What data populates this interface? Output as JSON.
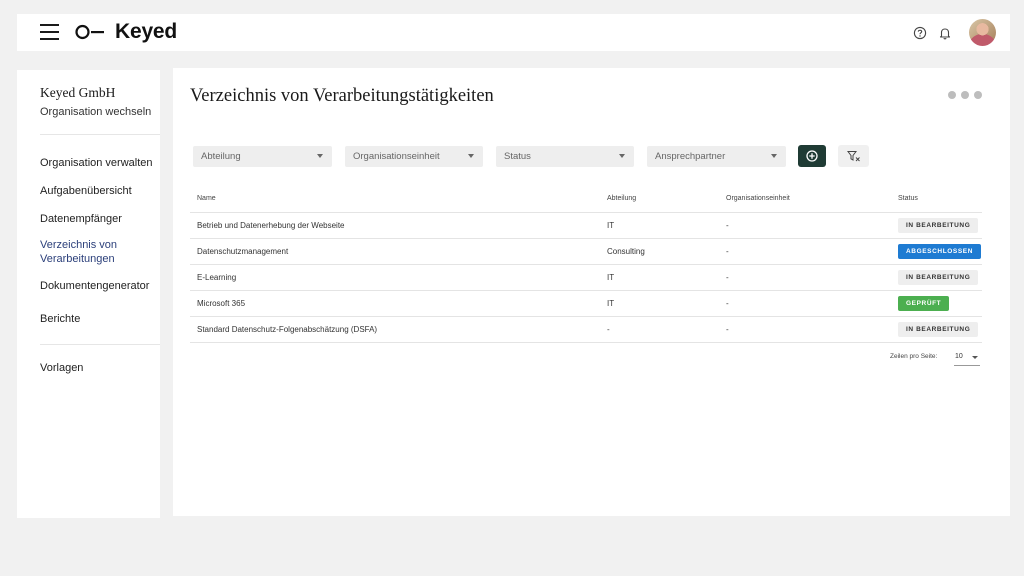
{
  "app": {
    "logo_text": "Keyed"
  },
  "colors": {
    "accent_dark": "#1f3b34",
    "status_done": "#1e7bd2",
    "status_checked": "#4caf50",
    "nav_active": "#2b3f7a"
  },
  "header": {
    "icons": [
      "menu-icon",
      "help-icon",
      "bell-icon",
      "avatar"
    ]
  },
  "sidebar": {
    "org_name": "Keyed GmbH",
    "org_switch": "Organisation wechseln",
    "items": [
      {
        "label": "Organisation verwalten"
      },
      {
        "label": "Aufgabenübersicht"
      },
      {
        "label": "Datenempfänger"
      },
      {
        "label": "Verzeichnis von Verarbeitungen",
        "active": true
      },
      {
        "label": "Dokumentengenerator"
      },
      {
        "label": "Berichte"
      },
      {
        "label": "Vorlagen"
      }
    ]
  },
  "main": {
    "title": "Verzeichnis von Verarbeitungstätigkeiten",
    "filters": [
      {
        "placeholder": "Abteilung"
      },
      {
        "placeholder": "Organisationseinheit"
      },
      {
        "placeholder": "Status"
      },
      {
        "placeholder": "Ansprechpartner"
      }
    ],
    "table": {
      "columns": [
        "Name",
        "Abteilung",
        "Organisationseinheit",
        "Status"
      ],
      "rows": [
        {
          "name": "Betrieb und Datenerhebung der Webseite",
          "abteilung": "IT",
          "org": "-",
          "status": "IN BEARBEITUNG",
          "status_type": "progress"
        },
        {
          "name": "Datenschutzmanagement",
          "abteilung": "Consulting",
          "org": "-",
          "status": "ABGESCHLOSSEN",
          "status_type": "done"
        },
        {
          "name": "E-Learning",
          "abteilung": "IT",
          "org": "-",
          "status": "IN BEARBEITUNG",
          "status_type": "progress"
        },
        {
          "name": "Microsoft 365",
          "abteilung": "IT",
          "org": "-",
          "status": "GEPRÜFT",
          "status_type": "checked"
        },
        {
          "name": "Standard Datenschutz-Folgenabschätzung (DSFA)",
          "abteilung": "-",
          "org": "-",
          "status": "IN BEARBEITUNG",
          "status_type": "progress"
        }
      ]
    },
    "pagination": {
      "label": "Zeilen pro Seite:",
      "value": "10"
    }
  }
}
